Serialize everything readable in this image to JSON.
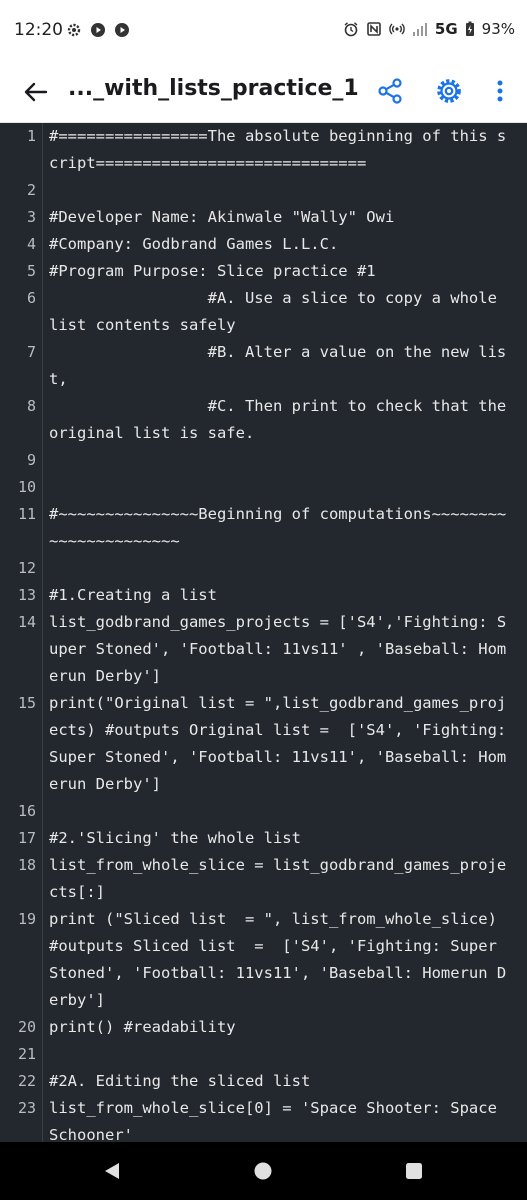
{
  "status_bar": {
    "time": "12:20",
    "left_icons": [
      "gear-icon",
      "play-circle-icon",
      "play-circle-icon"
    ],
    "right_icons": [
      "alarm-icon",
      "nfc-icon",
      "hotspot-icon",
      "signal-icon",
      "battery-charging-icon"
    ],
    "network": "5G",
    "battery": "93%"
  },
  "app_bar": {
    "title": "..._with_lists_practice_1",
    "actions": [
      "back-arrow-icon",
      "share-icon",
      "settings-icon",
      "more-vert-icon"
    ]
  },
  "editor": {
    "background": "#23272e",
    "lines": [
      {
        "num": "1",
        "text": "#================The absolute beginning of this script============================="
      },
      {
        "num": "2",
        "text": ""
      },
      {
        "num": "3",
        "text": "#Developer Name: Akinwale \"Wally\" Owi"
      },
      {
        "num": "4",
        "text": "#Company: Godbrand Games L.L.C."
      },
      {
        "num": "5",
        "text": "#Program Purpose: Slice practice #1"
      },
      {
        "num": "6",
        "text": "                 #A. Use a slice to copy a whole list contents safely"
      },
      {
        "num": "7",
        "text": "                 #B. Alter a value on the new list,"
      },
      {
        "num": "8",
        "text": "                 #C. Then print to check that the original list is safe."
      },
      {
        "num": "9",
        "text": ""
      },
      {
        "num": "10",
        "text": ""
      },
      {
        "num": "11",
        "text": "#~~~~~~~~~~~~~~~Beginning of computations~~~~~~~~~~~~~~~~~~~~~~"
      },
      {
        "num": "12",
        "text": ""
      },
      {
        "num": "13",
        "text": "#1.Creating a list"
      },
      {
        "num": "14",
        "text": "list_godbrand_games_projects = ['S4','Fighting: Super Stoned', 'Football: 11vs11' , 'Baseball: Homerun Derby']"
      },
      {
        "num": "15",
        "text": "print(\"Original list = \",list_godbrand_games_projects) #outputs Original list =  ['S4', 'Fighting: Super Stoned', 'Football: 11vs11', 'Baseball: Homerun Derby']"
      },
      {
        "num": "16",
        "text": ""
      },
      {
        "num": "17",
        "text": "#2.'Slicing' the whole list"
      },
      {
        "num": "18",
        "text": "list_from_whole_slice = list_godbrand_games_projects[:]"
      },
      {
        "num": "19",
        "text": "print (\"Sliced list  = \", list_from_whole_slice) #outputs Sliced list  =  ['S4', 'Fighting: Super Stoned', 'Football: 11vs11', 'Baseball: Homerun Derby']"
      },
      {
        "num": "20",
        "text": "print() #readability"
      },
      {
        "num": "21",
        "text": ""
      },
      {
        "num": "22",
        "text": "#2A. Editing the sliced list"
      },
      {
        "num": "23",
        "text": "list_from_whole_slice[0] = 'Space Shooter: Space Schooner'"
      }
    ]
  },
  "nav_bar": {
    "buttons": [
      "nav-back-icon",
      "nav-home-icon",
      "nav-recents-icon"
    ]
  }
}
